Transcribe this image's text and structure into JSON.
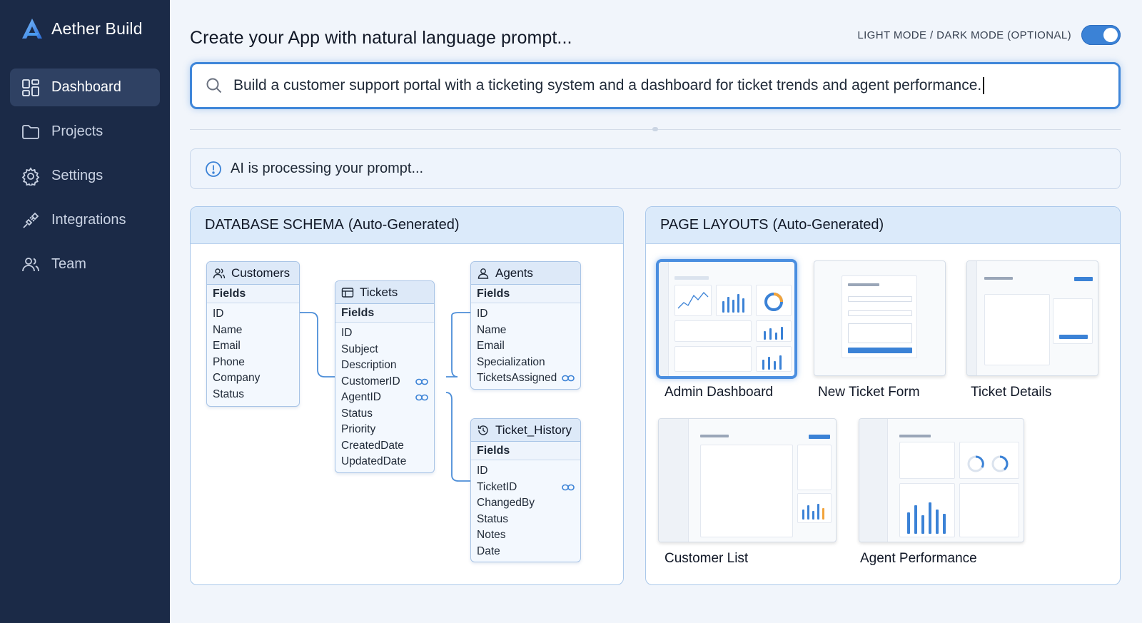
{
  "app": {
    "name": "Aether Build"
  },
  "sidebar": {
    "items": [
      {
        "label": "Dashboard",
        "icon": "dashboard-icon",
        "active": true
      },
      {
        "label": "Projects",
        "icon": "folder-icon",
        "active": false
      },
      {
        "label": "Settings",
        "icon": "gear-icon",
        "active": false
      },
      {
        "label": "Integrations",
        "icon": "plug-icon",
        "active": false
      },
      {
        "label": "Team",
        "icon": "team-icon",
        "active": false
      }
    ]
  },
  "header": {
    "title": "Create your App with natural language prompt...",
    "mode_label": "LIGHT MODE / DARK MODE (OPTIONAL)",
    "dark_mode_on": true
  },
  "prompt": {
    "value": "Build a customer support portal with a ticketing system and a dashboard for ticket trends and agent performance."
  },
  "status": {
    "text": "AI is processing your prompt..."
  },
  "schema_panel": {
    "title": "DATABASE SCHEMA",
    "subtitle": "(Auto-Generated)",
    "fields_label": "Fields",
    "tables": [
      {
        "name": "Customers",
        "icon": "users-icon",
        "fields": [
          {
            "name": "ID"
          },
          {
            "name": "Name"
          },
          {
            "name": "Email"
          },
          {
            "name": "Phone"
          },
          {
            "name": "Company"
          },
          {
            "name": "Status"
          }
        ]
      },
      {
        "name": "Tickets",
        "icon": "table-icon",
        "fields": [
          {
            "name": "ID"
          },
          {
            "name": "Subject"
          },
          {
            "name": "Description"
          },
          {
            "name": "CustomerID",
            "link": true
          },
          {
            "name": "AgentID",
            "link": true
          },
          {
            "name": "Status"
          },
          {
            "name": "Priority"
          },
          {
            "name": "CreatedDate"
          },
          {
            "name": "UpdatedDate"
          }
        ]
      },
      {
        "name": "Agents",
        "icon": "user-icon",
        "fields": [
          {
            "name": "ID"
          },
          {
            "name": "Name"
          },
          {
            "name": "Email"
          },
          {
            "name": "Specialization"
          },
          {
            "name": "TicketsAssigned",
            "link": true
          }
        ]
      },
      {
        "name": "Ticket_History",
        "icon": "history-icon",
        "fields": [
          {
            "name": "ID"
          },
          {
            "name": "TicketID",
            "link": true
          },
          {
            "name": "ChangedBy"
          },
          {
            "name": "Status"
          },
          {
            "name": "Notes"
          },
          {
            "name": "Date"
          }
        ]
      }
    ]
  },
  "layouts_panel": {
    "title": "PAGE LAYOUTS",
    "subtitle": "(Auto-Generated)",
    "pages": [
      {
        "name": "Admin Dashboard",
        "selected": true
      },
      {
        "name": "New Ticket Form",
        "selected": false
      },
      {
        "name": "Ticket Details",
        "selected": false
      },
      {
        "name": "Customer List",
        "selected": false
      },
      {
        "name": "Agent Performance",
        "selected": false
      }
    ]
  },
  "colors": {
    "sidebar": "#1b2a47",
    "accent": "#3b82d6",
    "panel_header": "#dbeafa"
  }
}
